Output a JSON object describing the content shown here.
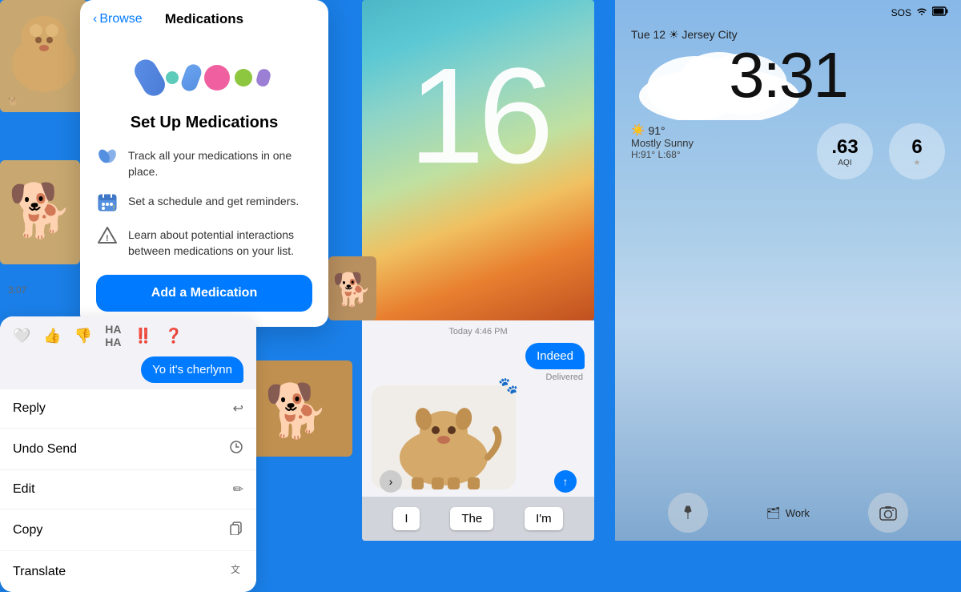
{
  "background": {
    "color": "#1a7fe8"
  },
  "medications_panel": {
    "nav_back": "Browse",
    "nav_title": "Medications",
    "heading": "Set Up Medications",
    "features": [
      {
        "icon": "pills-icon",
        "text": "Track all your medications in one place."
      },
      {
        "icon": "calendar-icon",
        "text": "Set a schedule and get reminders."
      },
      {
        "icon": "warning-icon",
        "text": "Learn about potential interactions between medications on your list."
      }
    ],
    "add_button": "Add a Medication"
  },
  "messages_context": {
    "reactions": [
      "heart",
      "thumbsup",
      "thumbsdown",
      "haha",
      "exclamation",
      "question"
    ],
    "bubble_text": "Yo it's cherlynn",
    "menu_items": [
      {
        "label": "Reply",
        "icon": "reply-icon"
      },
      {
        "label": "Undo Send",
        "icon": "undo-icon"
      },
      {
        "label": "Edit",
        "icon": "edit-icon"
      },
      {
        "label": "Copy",
        "icon": "copy-icon"
      },
      {
        "label": "Translate",
        "icon": "translate-icon"
      }
    ]
  },
  "ios_wallpaper": {
    "number": "16"
  },
  "messages_screen": {
    "timestamp": "Today 4:46 PM",
    "sent_text": "Indeed",
    "delivered": "Delivered",
    "keyboard_suggestions": [
      "I",
      "The",
      "I'm"
    ]
  },
  "lock_screen": {
    "status_bar": {
      "carrier": "SOS",
      "wifi": true,
      "battery": true
    },
    "date_row": "Tue 12 ☀ Jersey City",
    "time": "3:31",
    "weather": {
      "temp": "91°",
      "condition": "Mostly Sunny",
      "high": "H:91°",
      "low": "L:68°"
    },
    "widget_aqi": {
      "number": ".63",
      "label": "AQI"
    },
    "widget_uv": {
      "number": "6",
      "star": "★"
    },
    "bottom_buttons": [
      "flashlight-icon",
      "work-icon",
      "camera-icon"
    ],
    "center_label": "Work"
  },
  "time_indicator": "3:07"
}
